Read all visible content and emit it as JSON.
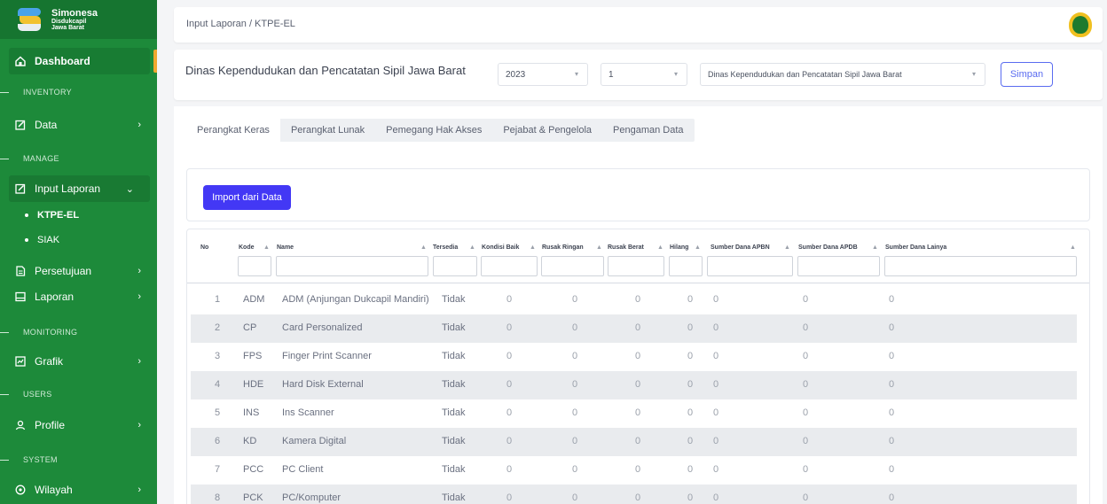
{
  "brand": {
    "name": "Simonesa",
    "line2": "Disdukcapil",
    "line3": "Jawa Barat"
  },
  "sidebar": {
    "dashboard": "Dashboard",
    "sections": {
      "inventory": "INVENTORY",
      "manage": "MANAGE",
      "monitoring": "MONITORING",
      "users": "USERS",
      "system": "SYSTEM"
    },
    "items": {
      "data": "Data",
      "input_laporan": "Input Laporan",
      "ktpe_el": "KTPE-EL",
      "siak": "SIAK",
      "persetujuan": "Persetujuan",
      "laporan": "Laporan",
      "grafik": "Grafik",
      "profile": "Profile",
      "wilayah": "Wilayah"
    }
  },
  "header": {
    "breadcrumb": "Input Laporan / KTPE-EL"
  },
  "filters": {
    "org_title": "Dinas Kependudukan dan Pencatatan Sipil Jawa Barat",
    "year": "2023",
    "period": "1",
    "agency": "Dinas Kependudukan dan Pencatatan Sipil Jawa Barat",
    "save_label": "Simpan"
  },
  "tabs": [
    "Perangkat Keras",
    "Perangkat Lunak",
    "Pemegang Hak Akses",
    "Pejabat & Pengelola",
    "Pengaman Data"
  ],
  "import_label": "Import dari Data",
  "table": {
    "columns": [
      "No",
      "Kode",
      "Name",
      "Tersedia",
      "Kondisi Baik",
      "Rusak Ringan",
      "Rusak Berat",
      "Hilang",
      "Sumber Dana APBN",
      "Sumber Dana APDB",
      "Sumber Dana Lainya"
    ],
    "rows": [
      [
        "1",
        "ADM",
        "ADM (Anjungan Dukcapil Mandiri)",
        "Tidak",
        "0",
        "0",
        "0",
        "0",
        "0",
        "0",
        "0"
      ],
      [
        "2",
        "CP",
        "Card Personalized",
        "Tidak",
        "0",
        "0",
        "0",
        "0",
        "0",
        "0",
        "0"
      ],
      [
        "3",
        "FPS",
        "Finger Print Scanner",
        "Tidak",
        "0",
        "0",
        "0",
        "0",
        "0",
        "0",
        "0"
      ],
      [
        "4",
        "HDE",
        "Hard Disk External",
        "Tidak",
        "0",
        "0",
        "0",
        "0",
        "0",
        "0",
        "0"
      ],
      [
        "5",
        "INS",
        "Ins Scanner",
        "Tidak",
        "0",
        "0",
        "0",
        "0",
        "0",
        "0",
        "0"
      ],
      [
        "6",
        "KD",
        "Kamera Digital",
        "Tidak",
        "0",
        "0",
        "0",
        "0",
        "0",
        "0",
        "0"
      ],
      [
        "7",
        "PCC",
        "PC Client",
        "Tidak",
        "0",
        "0",
        "0",
        "0",
        "0",
        "0",
        "0"
      ],
      [
        "8",
        "PCK",
        "PC/Komputer",
        "Tidak",
        "0",
        "0",
        "0",
        "0",
        "0",
        "0",
        "0"
      ]
    ]
  },
  "colors": {
    "sidebar": "#1d8a3a",
    "accent": "#4338f5",
    "simpan": "#5a6cf0",
    "marker": "#f0a830"
  }
}
